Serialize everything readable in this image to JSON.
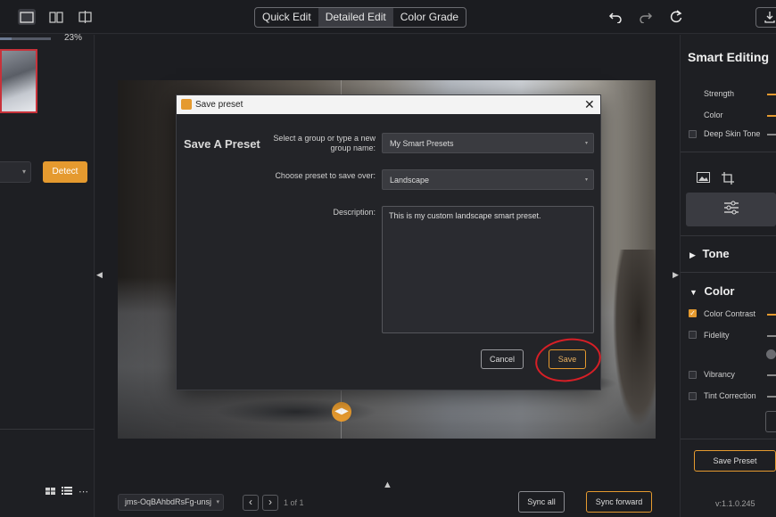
{
  "topbar": {
    "modes": [
      "Quick Edit",
      "Detailed Edit",
      "Color Grade"
    ],
    "active_mode": "Detailed Edit",
    "icons": [
      "single-view-icon",
      "compare-view-icon",
      "crop-view-icon",
      "undo-icon",
      "redo-icon",
      "reset-icon",
      "export-icon"
    ]
  },
  "left_panel": {
    "progress_text": "23%",
    "progress_value": 0.23,
    "detect_label": "Detect"
  },
  "canvas": {
    "handle_glyph": "◀▶"
  },
  "bottom_bar": {
    "file_name": "jms-OqBAhbdRsFg-unsj",
    "page_text": "1 of 1",
    "sync_all": "Sync all",
    "sync_forward": "Sync forward"
  },
  "right_panel": {
    "title": "Smart Editing",
    "strength": "Strength",
    "color": "Color",
    "deep_skin_tone": "Deep Skin Tone",
    "tone_section": "Tone",
    "color_section": "Color",
    "color_contrast": "Color Contrast",
    "fidelity": "Fidelity",
    "vibrancy": "Vibrancy",
    "tint_correction": "Tint Correction",
    "save_preset": "Save Preset",
    "version": "v:1.1.0.245"
  },
  "dialog": {
    "title": "Save preset",
    "heading": "Save A Preset",
    "group_label_line1": "Select a group or type a new",
    "group_label_line2": "group name:",
    "group_value": "My Smart Presets",
    "preset_label": "Choose preset to save over:",
    "preset_value": "Landscape",
    "description_label": "Description:",
    "description_value": "This is my custom landscape smart preset.",
    "cancel": "Cancel",
    "save": "Save"
  },
  "colors": {
    "accent": "#e59a2f",
    "annotation": "#d71f26"
  }
}
